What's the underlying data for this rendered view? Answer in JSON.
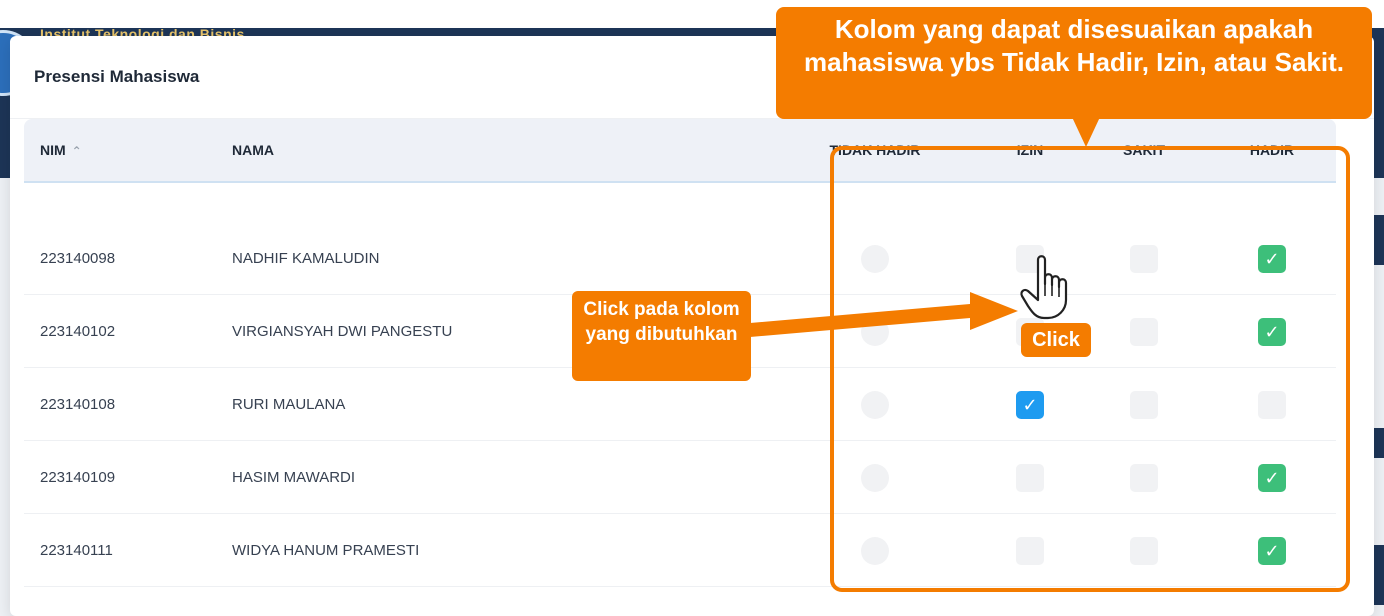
{
  "background": {
    "institution_text": "Institut Teknologi dan Bisnis"
  },
  "modal": {
    "title": "Presensi Mahasiswa"
  },
  "table": {
    "columns": {
      "nim": "NIM",
      "nama": "NAMA",
      "tidak_hadir": "TIDAK HADIR",
      "izin": "IZIN",
      "sakit": "SAKIT",
      "hadir": "HADIR"
    },
    "rows": [
      {
        "nim": "223140098",
        "nama": "NADHIF KAMALUDIN",
        "tidak_hadir": false,
        "izin": false,
        "sakit": false,
        "hadir": true
      },
      {
        "nim": "223140102",
        "nama": "VIRGIANSYAH DWI PANGESTU",
        "tidak_hadir": false,
        "izin": false,
        "sakit": false,
        "hadir": true
      },
      {
        "nim": "223140108",
        "nama": "RURI MAULANA",
        "tidak_hadir": false,
        "izin": true,
        "sakit": false,
        "hadir": false
      },
      {
        "nim": "223140109",
        "nama": "HASIM MAWARDI",
        "tidak_hadir": false,
        "izin": false,
        "sakit": false,
        "hadir": true
      },
      {
        "nim": "223140111",
        "nama": "WIDYA HANUM PRAMESTI",
        "tidak_hadir": false,
        "izin": false,
        "sakit": false,
        "hadir": true
      }
    ]
  },
  "annotations": {
    "top_callout": "Kolom yang dapat disesuaikan apakah mahasiswa ybs Tidak Hadir, Izin, atau Sakit.",
    "mid_callout": "Click pada kolom yang dibutuhkan",
    "click_badge": "Click"
  },
  "colors": {
    "accent_orange": "#f47c00",
    "hadir_green": "#3dbf7a",
    "izin_blue": "#1e9bf0"
  },
  "icons": {
    "check": "✓",
    "sort_up": "⌃"
  }
}
